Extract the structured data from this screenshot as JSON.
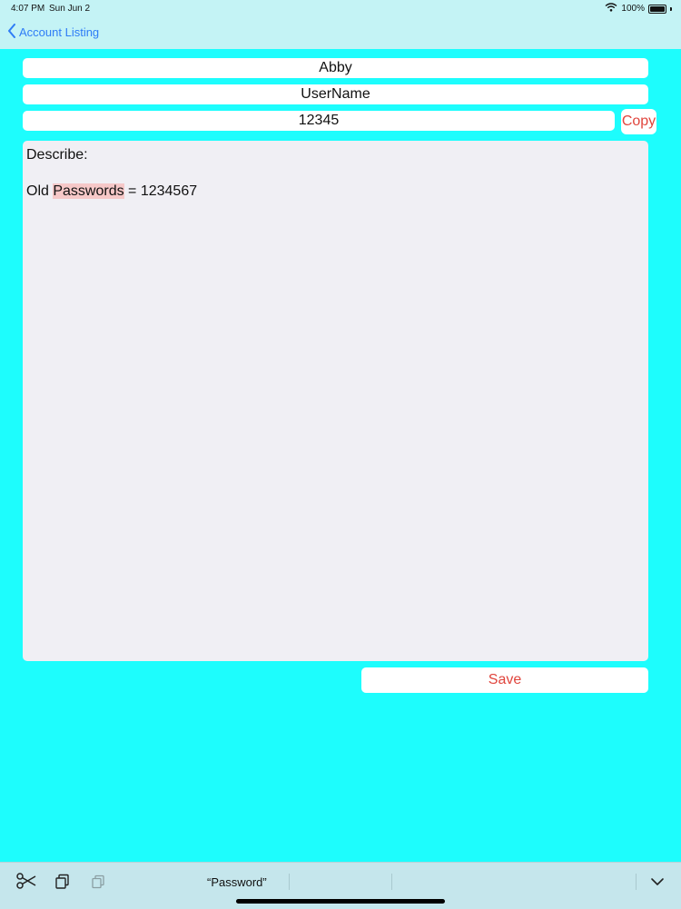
{
  "status": {
    "time": "4:07 PM",
    "date": "Sun Jun 2",
    "battery": "100%"
  },
  "nav": {
    "back_label": "Account Listing"
  },
  "form": {
    "account_name": "Abby",
    "username": "UserName",
    "password": "12345",
    "copy_label": "Copy",
    "notes_line1": "Describe:",
    "notes_line2_before": "Old ",
    "notes_line2_highlight": "Passwords",
    "notes_line2_after": " = 1234567",
    "save_label": "Save"
  },
  "keyboard": {
    "suggestion": "“Password”"
  },
  "colors": {
    "background": "#1dfdfd",
    "bar": "#c4f3f5",
    "accent_blue": "#2e7cf6",
    "accent_red": "#e0453d",
    "highlight": "#f6c8c8"
  },
  "icons": [
    "wifi-icon",
    "battery-icon",
    "chevron-left-icon",
    "scissors-icon",
    "copy-icon",
    "paste-icon",
    "chevron-down-icon"
  ]
}
